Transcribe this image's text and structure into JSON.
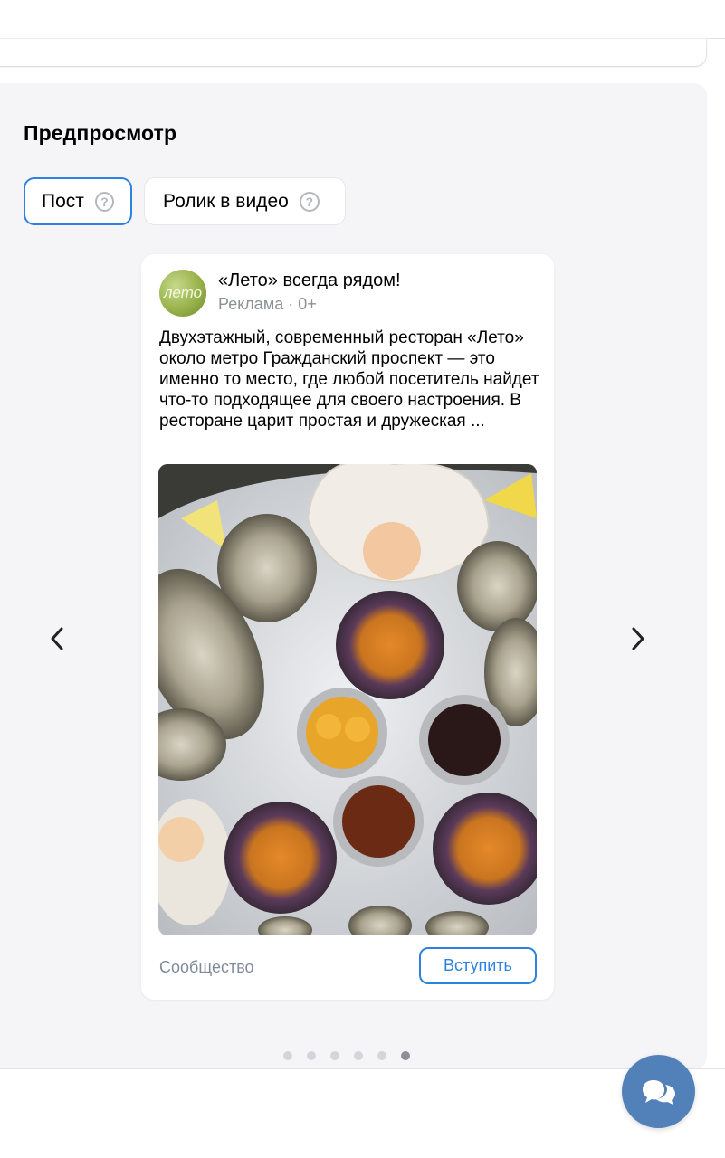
{
  "preview": {
    "title": "Предпросмотр",
    "tabs": [
      {
        "label": "Пост",
        "active": true
      },
      {
        "label": "Ролик в видео",
        "active": false
      }
    ],
    "help_glyph": "?"
  },
  "post": {
    "avatar_text": "лето",
    "title": "«Лето» всегда рядом!",
    "subtitle": "Реклама · 0+",
    "text": "Двухэтажный, современный ресторан «Лето» около метро Гражданский проспект — это именно то место, где любой посетитель найдет что-то подходящее для своего настроения. В ресторане царит простая и дружеская ...",
    "community_label": "Сообщество",
    "join_label": "Вступить"
  },
  "carousel": {
    "total": 6,
    "active_index": 5
  },
  "icons": {
    "prev": "chevron-left-icon",
    "next": "chevron-right-icon",
    "help": "question-circle-icon",
    "chat": "chat-bubbles-icon"
  },
  "colors": {
    "accent": "#2d81e0",
    "panel_bg": "#f5f5f7",
    "secondary_text": "#818c99",
    "fab": "#5181b8"
  }
}
